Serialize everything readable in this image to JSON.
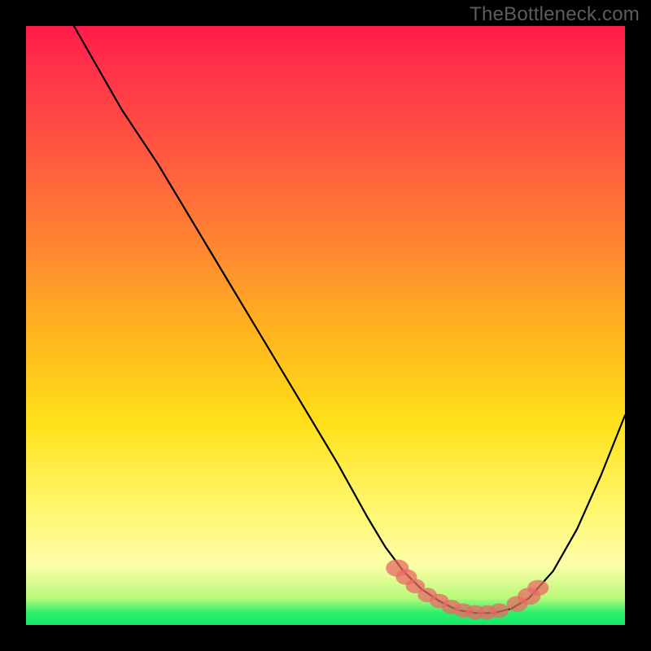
{
  "watermark": "TheBottleneck.com",
  "colors": {
    "background": "#000000",
    "gradient_top": "#ff1a4a",
    "gradient_mid1": "#ff8a30",
    "gradient_mid2": "#ffe019",
    "gradient_low": "#fdfda8",
    "gradient_bottom": "#14e86a",
    "curve": "#000000",
    "marker": "#e86a64"
  },
  "chart_data": {
    "type": "line",
    "title": "",
    "xlabel": "",
    "ylabel": "",
    "xlim": [
      0,
      100
    ],
    "ylim": [
      0,
      100
    ],
    "series": [
      {
        "name": "bottleneck-curve",
        "x": [
          8,
          12,
          16,
          22,
          28,
          34,
          40,
          46,
          52,
          57,
          60,
          63,
          66,
          69,
          72,
          75,
          78,
          81,
          84,
          88,
          92,
          96,
          100
        ],
        "y": [
          100,
          93,
          86,
          77,
          67,
          57,
          47,
          37,
          27,
          18,
          13,
          9,
          6,
          4,
          2.5,
          2,
          2,
          2.7,
          4.5,
          9,
          16,
          25,
          35
        ]
      }
    ],
    "markers": {
      "name": "highlight-region",
      "points": [
        {
          "x": 62,
          "y": 9.5,
          "r": 1.2
        },
        {
          "x": 63.5,
          "y": 8.0,
          "r": 1.1
        },
        {
          "x": 65,
          "y": 6.5,
          "r": 1.0
        },
        {
          "x": 67,
          "y": 5.0,
          "r": 1.0
        },
        {
          "x": 69,
          "y": 4.0,
          "r": 1.0
        },
        {
          "x": 71,
          "y": 3.0,
          "r": 1.0
        },
        {
          "x": 73,
          "y": 2.4,
          "r": 1.0
        },
        {
          "x": 75,
          "y": 2.1,
          "r": 1.0
        },
        {
          "x": 77,
          "y": 2.1,
          "r": 1.0
        },
        {
          "x": 79,
          "y": 2.4,
          "r": 1.0
        },
        {
          "x": 82,
          "y": 3.5,
          "r": 1.1
        },
        {
          "x": 84,
          "y": 4.8,
          "r": 1.2
        },
        {
          "x": 85.5,
          "y": 6.2,
          "r": 1.1
        }
      ]
    }
  }
}
